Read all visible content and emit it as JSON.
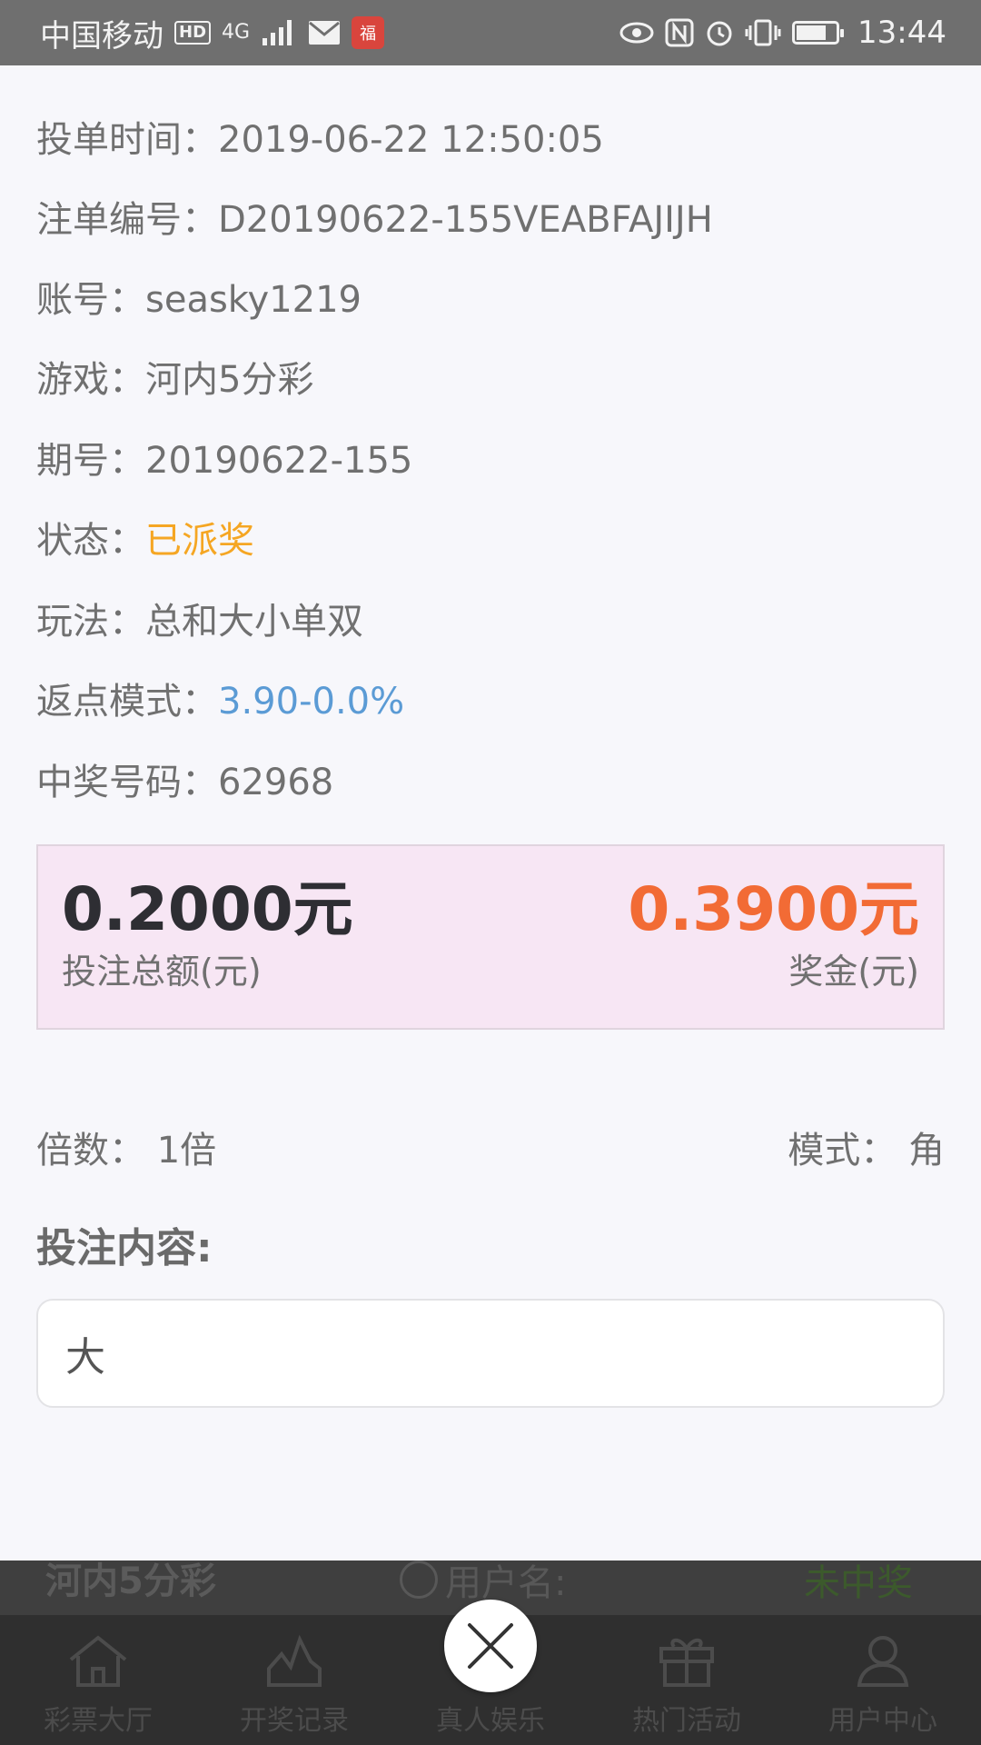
{
  "status_bar": {
    "carrier": "中国移动",
    "hd_badge": "HD",
    "network": "4G",
    "time": "13:44",
    "icons": [
      "hd-icon",
      "signal-icon",
      "mail-icon",
      "app-notification-icon",
      "eye-icon",
      "nfc-icon",
      "alarm-icon",
      "vibrate-icon",
      "battery-icon"
    ]
  },
  "details": {
    "order_time": {
      "label": "投单时间：",
      "value": "2019-06-22 12:50:05"
    },
    "order_no": {
      "label": "注单编号：",
      "value": "D20190622-155VEABFAJIJH"
    },
    "account": {
      "label": "账号：",
      "value": "seasky1219"
    },
    "game": {
      "label": "游戏：",
      "value": "河内5分彩"
    },
    "period": {
      "label": "期号：",
      "value": "20190622-155"
    },
    "status": {
      "label": "状态：",
      "value": "已派奖",
      "color": "#f5a623"
    },
    "play_type": {
      "label": "玩法：",
      "value": "总和大小单双"
    },
    "rebate_mode": {
      "label": "返点模式：",
      "value": "3.90-0.0%",
      "color": "#5b9bd5"
    },
    "winning_number": {
      "label": "中奖号码：",
      "value": "62968"
    }
  },
  "amounts": {
    "total_bet": {
      "value": "0.2000元",
      "label": "投注总额(元)"
    },
    "prize": {
      "value": "0.3900元",
      "label": "奖金(元)",
      "color": "#f26b35"
    }
  },
  "multiplier": {
    "label": "倍数：",
    "value": "1倍"
  },
  "mode": {
    "label": "模式：",
    "value": "角"
  },
  "bet_content": {
    "title": "投注内容:",
    "value": "大"
  },
  "background_row": {
    "game": "河内5分彩",
    "user_label": "用户名:",
    "status": "未中奖"
  },
  "nav": [
    {
      "label": "彩票大厅",
      "icon": "home-icon"
    },
    {
      "label": "开奖记录",
      "icon": "chart-icon"
    },
    {
      "label": "真人娱乐",
      "icon": "live-casino-icon"
    },
    {
      "label": "热门活动",
      "icon": "gift-icon"
    },
    {
      "label": "用户中心",
      "icon": "user-icon"
    }
  ],
  "close_button": {
    "icon": "close-icon"
  }
}
